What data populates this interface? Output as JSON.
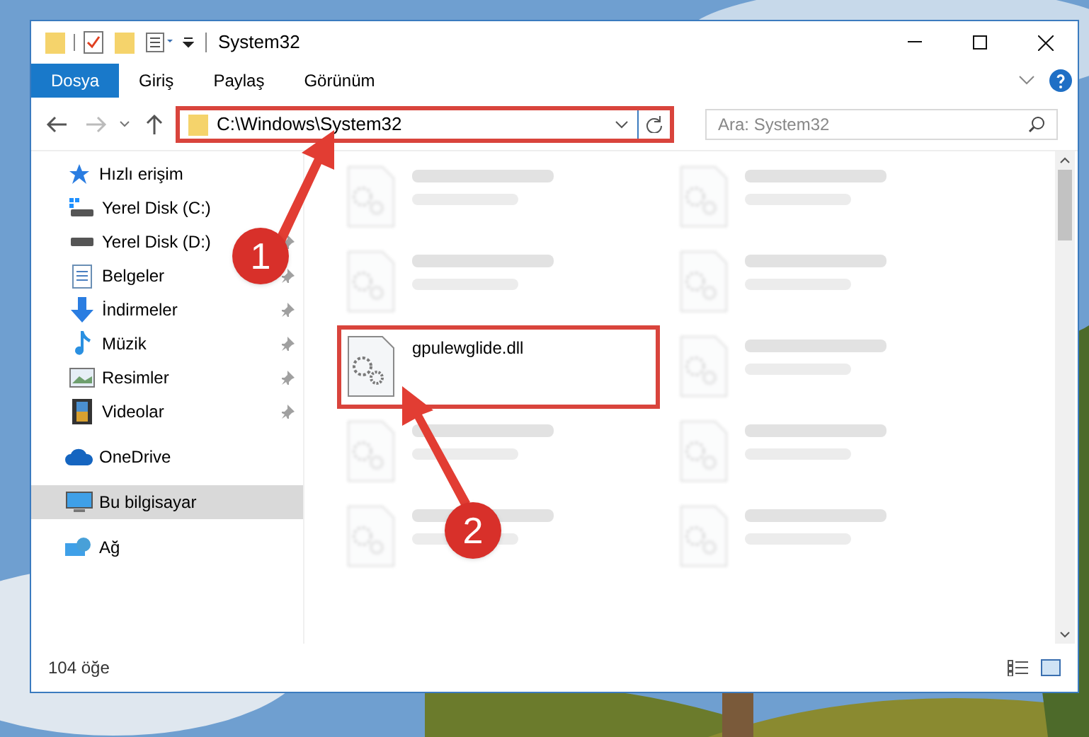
{
  "window": {
    "title": "System32"
  },
  "ribbon_tabs": [
    {
      "label": "Dosya",
      "kind": "file"
    },
    {
      "label": "Giriş",
      "kind": "tab"
    },
    {
      "label": "Paylaş",
      "kind": "tab"
    },
    {
      "label": "Görünüm",
      "kind": "tab"
    }
  ],
  "address_bar": {
    "path": "C:\\Windows\\System32",
    "highlighted": true
  },
  "search": {
    "placeholder": "Ara: System32"
  },
  "sidebar": {
    "items": [
      {
        "label": "Hızlı erişim",
        "kind": "star",
        "pinned": false,
        "selected": false,
        "children": [
          {
            "label": "Yerel Disk (C:)",
            "kind": "drive-c",
            "pinned": false,
            "selected": false
          },
          {
            "label": "Yerel Disk (D:)",
            "kind": "drive",
            "pinned": true,
            "selected": false
          },
          {
            "label": "Belgeler",
            "kind": "docs",
            "pinned": true,
            "selected": false
          },
          {
            "label": "İndirmeler",
            "kind": "download",
            "pinned": true,
            "selected": false
          },
          {
            "label": "Müzik",
            "kind": "music",
            "pinned": true,
            "selected": false
          },
          {
            "label": "Resimler",
            "kind": "pictures",
            "pinned": true,
            "selected": false
          },
          {
            "label": "Videolar",
            "kind": "videos",
            "pinned": true,
            "selected": false
          }
        ]
      },
      {
        "label": "OneDrive",
        "kind": "cloud",
        "pinned": false,
        "selected": false
      },
      {
        "label": "Bu bilgisayar",
        "kind": "pc",
        "pinned": false,
        "selected": true
      },
      {
        "label": "Ağ",
        "kind": "network",
        "pinned": false,
        "selected": false
      }
    ]
  },
  "files": [
    {
      "blurred": true,
      "highlighted": false
    },
    {
      "blurred": true,
      "highlighted": false
    },
    {
      "blurred": true,
      "highlighted": false
    },
    {
      "blurred": true,
      "highlighted": false
    },
    {
      "name": "gpulewglide.dll",
      "blurred": false,
      "highlighted": true
    },
    {
      "blurred": true,
      "highlighted": false
    },
    {
      "blurred": true,
      "highlighted": false
    },
    {
      "blurred": true,
      "highlighted": false
    },
    {
      "blurred": true,
      "highlighted": false
    },
    {
      "blurred": true,
      "highlighted": false
    }
  ],
  "status_bar": {
    "item_count": "104 öğe"
  },
  "annotations": [
    {
      "number": "1"
    },
    {
      "number": "2"
    }
  ]
}
